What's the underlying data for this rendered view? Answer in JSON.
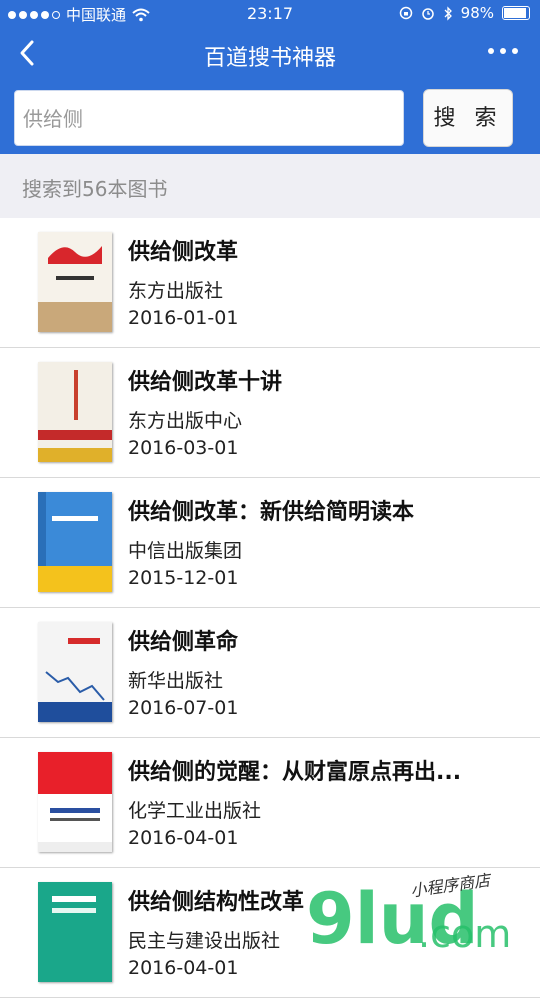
{
  "status_bar": {
    "carrier": "中国联通",
    "time": "23:17",
    "battery": "98%",
    "battery_level": 0.98
  },
  "nav": {
    "title": "百道搜书神器"
  },
  "search": {
    "value": "供给侧",
    "button_label": "搜 索"
  },
  "result_summary": "搜索到56本图书",
  "books": [
    {
      "title": "供给侧改革",
      "publisher": "东方出版社",
      "date": "2016-01-01"
    },
    {
      "title": "供给侧改革十讲",
      "publisher": "东方出版中心",
      "date": "2016-03-01"
    },
    {
      "title": "供给侧改革：新供给简明读本",
      "publisher": "中信出版集团",
      "date": "2015-12-01"
    },
    {
      "title": "供给侧革命",
      "publisher": "新华出版社",
      "date": "2016-07-01"
    },
    {
      "title": "供给侧的觉醒：从财富原点再出...",
      "publisher": "化学工业出版社",
      "date": "2016-04-01"
    },
    {
      "title": "供给侧结构性改革",
      "publisher": "民主与建设出版社",
      "date": "2016-04-01"
    }
  ],
  "watermark": {
    "brand": "9lud",
    "domain": ".com",
    "tagline": "小程序商店"
  },
  "colors": {
    "brand_blue": "#2f6fd6",
    "watermark_green": "#27c06a"
  }
}
